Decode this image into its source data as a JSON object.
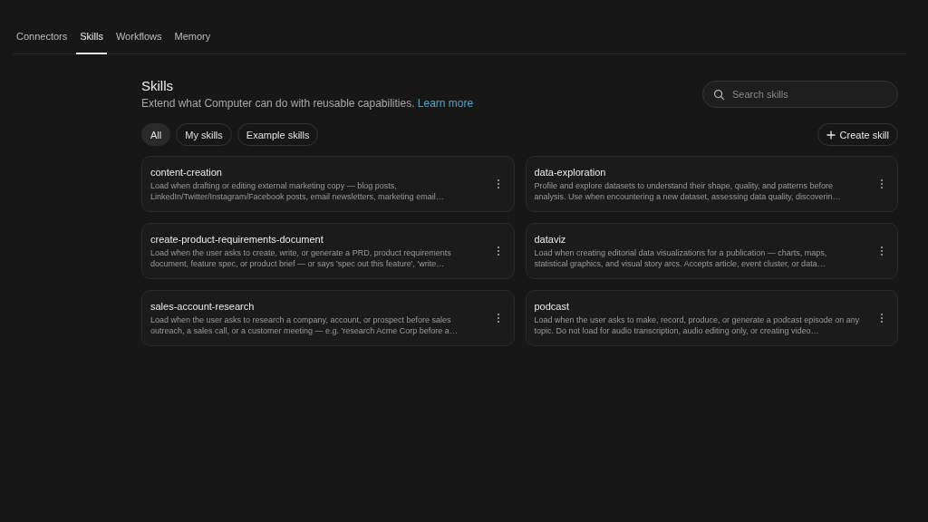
{
  "tabs": [
    {
      "label": "Connectors",
      "selected": false
    },
    {
      "label": "Skills",
      "selected": true
    },
    {
      "label": "Workflows",
      "selected": false
    },
    {
      "label": "Memory",
      "selected": false
    }
  ],
  "header": {
    "title": "Skills",
    "subtitle": "Extend what Computer can do with reusable capabilities.",
    "link": "Learn more"
  },
  "search": {
    "placeholder": "Search skills"
  },
  "filters": [
    {
      "label": "All",
      "selected": true
    },
    {
      "label": "My skills",
      "selected": false
    },
    {
      "label": "Example skills",
      "selected": false
    }
  ],
  "create_button": {
    "label": "Create skill"
  },
  "skills": [
    {
      "name": "content-creation",
      "description": "Load when drafting or editing external marketing copy — blog posts, LinkedIn/Twitter/Instagram/Facebook posts, email newsletters, marketing email…"
    },
    {
      "name": "data-exploration",
      "description": "Profile and explore datasets to understand their shape, quality, and patterns before analysis. Use when encountering a new dataset, assessing data quality, discoverin…"
    },
    {
      "name": "create-product-requirements-document",
      "description": "Load when the user asks to create, write, or generate a PRD, product requirements document, feature spec, or product brief — or says 'spec out this feature', 'write…"
    },
    {
      "name": "dataviz",
      "description": "Load when creating editorial data visualizations for a publication — charts, maps, statistical graphics, and visual story arcs. Accepts article, event cluster, or data…"
    },
    {
      "name": "sales-account-research",
      "description": "Load when the user asks to research a company, account, or prospect before sales outreach, a sales call, or a customer meeting — e.g. 'research Acme Corp before a…"
    },
    {
      "name": "podcast",
      "description": "Load when the user asks to make, record, produce, or generate a podcast episode on any topic. Do not load for audio transcription, audio editing only, or creating video…"
    }
  ]
}
